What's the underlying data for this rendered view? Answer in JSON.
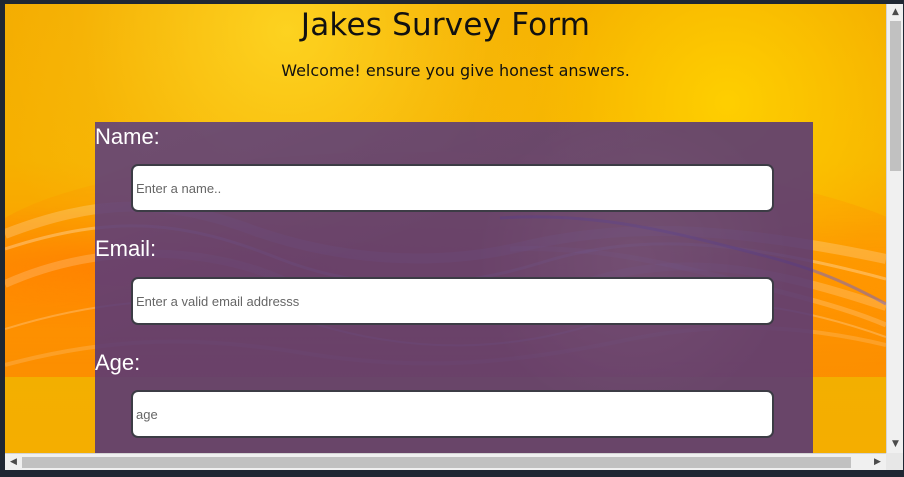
{
  "page": {
    "title": "Jakes Survey Form",
    "subtitle": "Welcome! ensure you give honest answers."
  },
  "form": {
    "fields": [
      {
        "label": "Name:",
        "placeholder": "Enter a name..",
        "value": ""
      },
      {
        "label": "Email:",
        "placeholder": "Enter a valid email addresss",
        "value": ""
      },
      {
        "label": "Age:",
        "placeholder": "age",
        "value": ""
      }
    ]
  },
  "scrollbars": {
    "vertical_up_icon": "triangle-up-icon",
    "vertical_down_icon": "triangle-down-icon",
    "horizontal_left_icon": "triangle-left-icon",
    "horizontal_right_icon": "triangle-right-icon"
  },
  "colors": {
    "background_orange": "#f4ab00",
    "form_panel_purple": "#553778",
    "label_text": "#ffffff",
    "input_border": "#3c3c45"
  }
}
